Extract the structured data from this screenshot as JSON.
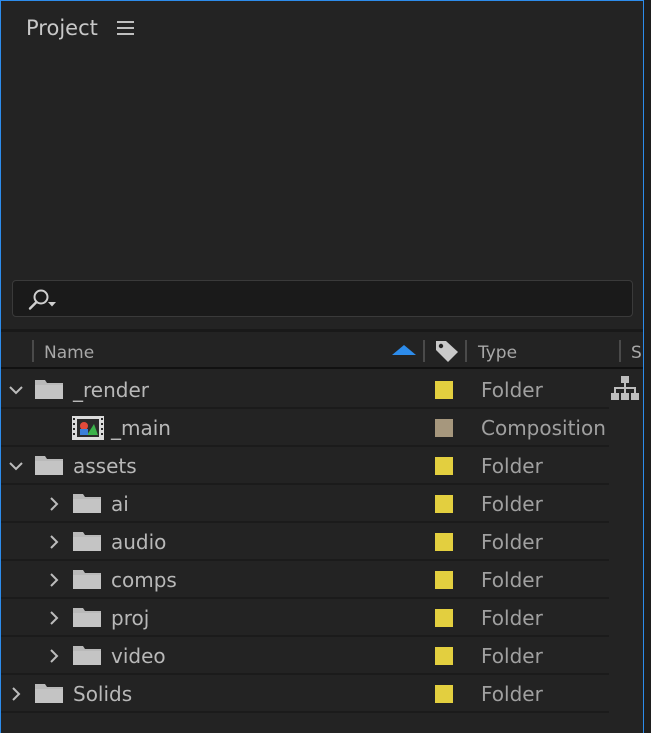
{
  "panel": {
    "title": "Project",
    "menu_icon": "hamburger-menu-icon"
  },
  "search": {
    "icon": "search-dropdown-icon",
    "value": "",
    "placeholder": ""
  },
  "columns": {
    "name": "Name",
    "label_icon": "tag-icon",
    "type": "Type",
    "next": "S",
    "sort": "ascending",
    "sort_color": "#2d8ceb"
  },
  "flowchart_icon": "flowchart-icon",
  "rows": [
    {
      "name": "_render",
      "type": "Folder",
      "kind": "folder",
      "expanded": true,
      "depth": 0,
      "color": "#e3cf3f"
    },
    {
      "name": "_main",
      "type": "Composition",
      "kind": "composition",
      "expanded": null,
      "depth": 1,
      "color": "#a6977d"
    },
    {
      "name": "assets",
      "type": "Folder",
      "kind": "folder",
      "expanded": true,
      "depth": 0,
      "color": "#e3cf3f"
    },
    {
      "name": "ai",
      "type": "Folder",
      "kind": "folder",
      "expanded": false,
      "depth": 1,
      "color": "#e3cf3f"
    },
    {
      "name": "audio",
      "type": "Folder",
      "kind": "folder",
      "expanded": false,
      "depth": 1,
      "color": "#e3cf3f"
    },
    {
      "name": "comps",
      "type": "Folder",
      "kind": "folder",
      "expanded": false,
      "depth": 1,
      "color": "#e3cf3f"
    },
    {
      "name": "proj",
      "type": "Folder",
      "kind": "folder",
      "expanded": false,
      "depth": 1,
      "color": "#e3cf3f"
    },
    {
      "name": "video",
      "type": "Folder",
      "kind": "folder",
      "expanded": false,
      "depth": 1,
      "color": "#e3cf3f"
    },
    {
      "name": "Solids",
      "type": "Folder",
      "kind": "folder",
      "expanded": false,
      "depth": 0,
      "color": "#e3cf3f"
    }
  ]
}
